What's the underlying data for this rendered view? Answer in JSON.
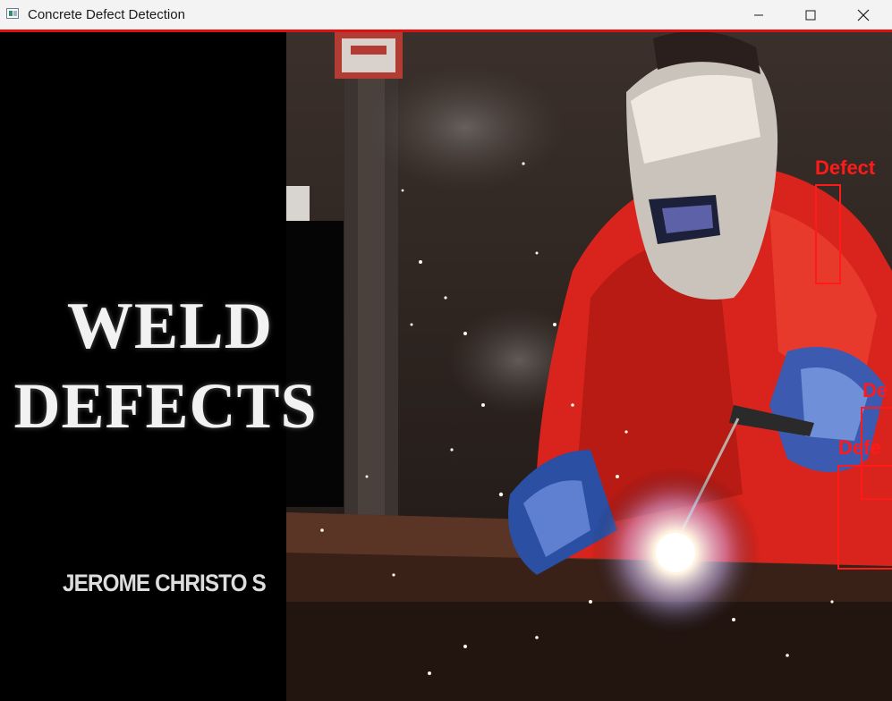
{
  "window": {
    "title": "Concrete Defect Detection",
    "controls": [
      "minimize",
      "maximize",
      "close"
    ]
  },
  "image": {
    "headline_line1": "WELD",
    "headline_line2": "DEFECTS",
    "author": "JEROME CHRISTO S"
  },
  "detections": [
    {
      "label": "Defect"
    },
    {
      "label": "De"
    },
    {
      "label": "Defe"
    }
  ],
  "colors": {
    "detection": "#ff1a1a",
    "titlebar": "#f3f3f3",
    "suit": "#d8241c"
  }
}
